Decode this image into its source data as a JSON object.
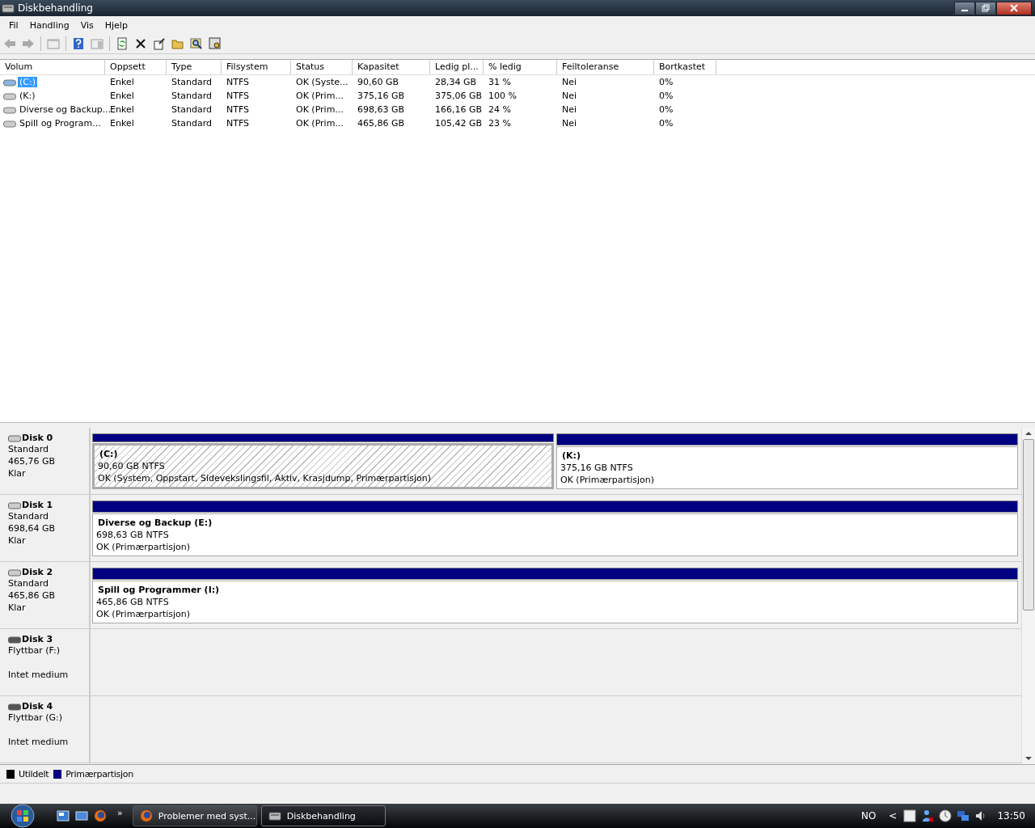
{
  "window": {
    "title": "Diskbehandling"
  },
  "menu": [
    "Fil",
    "Handling",
    "Vis",
    "Hjelp"
  ],
  "volume_table": {
    "columns": [
      "Volum",
      "Oppsett",
      "Type",
      "Filsystem",
      "Status",
      "Kapasitet",
      "Ledig pl...",
      "% ledig",
      "Feiltoleranse",
      "Bortkastet"
    ],
    "rows": [
      {
        "selected": true,
        "cells": [
          "(C:)",
          "Enkel",
          "Standard",
          "NTFS",
          "OK (Syste...",
          "90,60 GB",
          "28,34 GB",
          "31 %",
          "Nei",
          "0%"
        ]
      },
      {
        "selected": false,
        "cells": [
          "(K:)",
          "Enkel",
          "Standard",
          "NTFS",
          "OK (Prim...",
          "375,16 GB",
          "375,06 GB",
          "100 %",
          "Nei",
          "0%"
        ]
      },
      {
        "selected": false,
        "cells": [
          "Diverse og Backup...",
          "Enkel",
          "Standard",
          "NTFS",
          "OK (Prim...",
          "698,63 GB",
          "166,16 GB",
          "24 %",
          "Nei",
          "0%"
        ]
      },
      {
        "selected": false,
        "cells": [
          "Spill og Program...",
          "Enkel",
          "Standard",
          "NTFS",
          "OK (Prim...",
          "465,86 GB",
          "105,42 GB",
          "23 %",
          "Nei",
          "0%"
        ]
      }
    ]
  },
  "disks": [
    {
      "kind": "fixed",
      "name": "Disk 0",
      "type": "Standard",
      "size": "465,76 GB",
      "status": "Klar",
      "partitions": [
        {
          "selected": true,
          "label": "(C:)",
          "size": "90,60 GB NTFS",
          "status": "OK (System, Oppstart, Sidevekslingsfil, Aktiv, Krasjdump, Primærpartisjon)"
        },
        {
          "selected": false,
          "label": "(K:)",
          "size": "375,16 GB NTFS",
          "status": "OK (Primærpartisjon)"
        }
      ]
    },
    {
      "kind": "fixed",
      "name": "Disk 1",
      "type": "Standard",
      "size": "698,64 GB",
      "status": "Klar",
      "partitions": [
        {
          "selected": false,
          "label": "Diverse og Backup  (E:)",
          "size": "698,63 GB NTFS",
          "status": "OK (Primærpartisjon)"
        }
      ]
    },
    {
      "kind": "fixed",
      "name": "Disk 2",
      "type": "Standard",
      "size": "465,86 GB",
      "status": "Klar",
      "partitions": [
        {
          "selected": false,
          "label": "Spill og Programmer  (I:)",
          "size": "465,86 GB NTFS",
          "status": "OK (Primærpartisjon)"
        }
      ]
    },
    {
      "kind": "removable",
      "name": "Disk 3",
      "type": "Flyttbar (F:)",
      "status": "Intet medium"
    },
    {
      "kind": "removable",
      "name": "Disk 4",
      "type": "Flyttbar (G:)",
      "status": "Intet medium"
    }
  ],
  "legend": [
    {
      "label": "Utildelt",
      "color": "#000000"
    },
    {
      "label": "Primærpartisjon",
      "color": "#000080"
    }
  ],
  "taskbar": {
    "overflow": "»",
    "tasks": [
      {
        "label": "Problemer med syst...",
        "kind": "browser",
        "selected": false
      },
      {
        "label": "Diskbehandling",
        "kind": "disk",
        "selected": true
      }
    ],
    "language": "NO",
    "tray_expand": "<",
    "clock": "13:50"
  }
}
